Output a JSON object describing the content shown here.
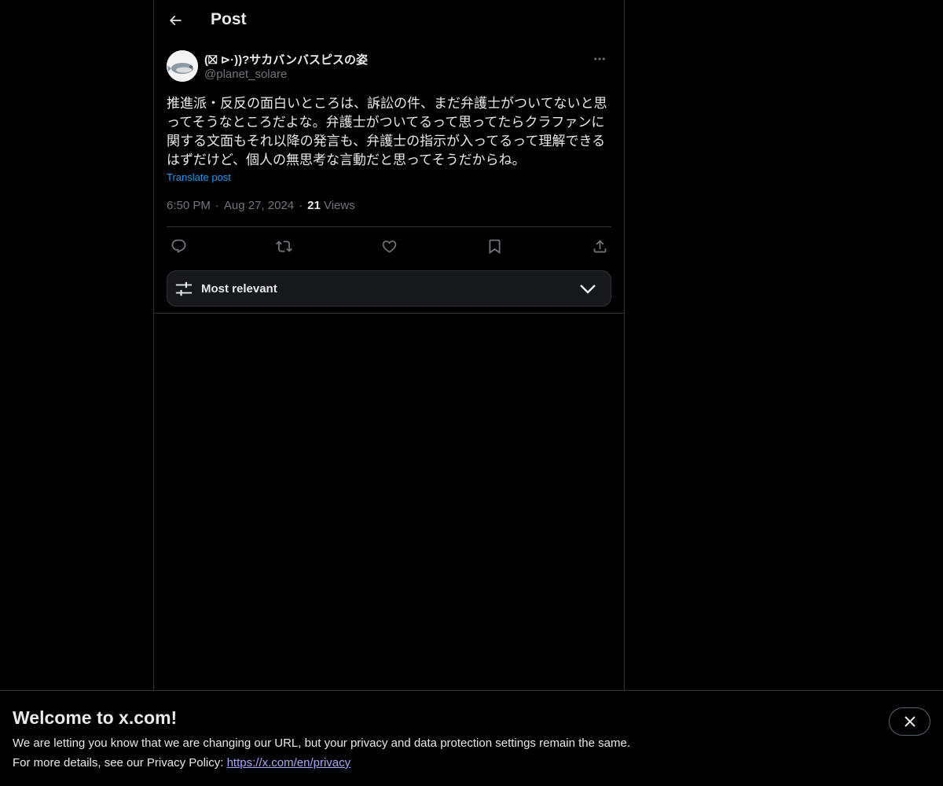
{
  "header": {
    "title": "Post",
    "back_icon": "arrow-left-icon"
  },
  "post": {
    "display_name": "(⛝ ⊳·))?サカバンバスピスの姿",
    "handle": "@planet_solare",
    "text": "推進派・反反の面白いところは、訴訟の件、まだ弁護士がついてないと思ってそうなところだよな。弁護士がついてるって思ってたらクラファンに関する文面もそれ以降の発言も、弁護士の指示が入ってるって理解できるはずだけど、個人の無思考な言動だと思ってそうだからね。",
    "translate_label": "Translate post",
    "time": "6:50 PM",
    "date": "Aug 27, 2024",
    "views_count": "21",
    "views_label": "Views",
    "separator": "·"
  },
  "actions": [
    {
      "name": "reply",
      "icon": "reply-icon"
    },
    {
      "name": "repost",
      "icon": "repost-icon"
    },
    {
      "name": "like",
      "icon": "heart-icon"
    },
    {
      "name": "bookmark",
      "icon": "bookmark-icon"
    },
    {
      "name": "share",
      "icon": "share-icon"
    }
  ],
  "sort": {
    "label": "Most relevant",
    "icon": "sliders-icon"
  },
  "banner": {
    "title": "Welcome to x.com!",
    "line1": "We are letting you know that we are changing our URL, but your privacy and data protection settings remain the same.",
    "line2_prefix": "For more details, see our Privacy Policy: ",
    "link_text": "https://x.com/en/privacy",
    "close_icon": "close-icon"
  },
  "colors": {
    "background": "#000000",
    "text_primary": "#e7e9ea",
    "text_secondary": "#71767b",
    "accent": "#1d9bf0",
    "border": "#2f3336",
    "link": "#a7a8f8"
  }
}
